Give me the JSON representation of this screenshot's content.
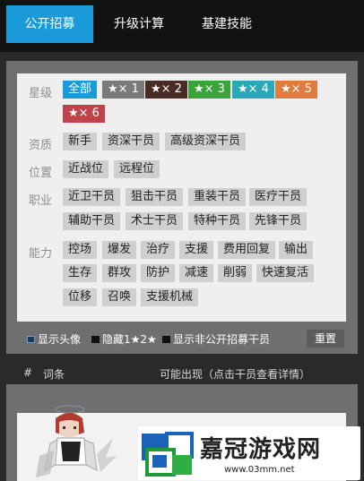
{
  "tabs": [
    {
      "label": "公开招募",
      "active": true
    },
    {
      "label": "升级计算",
      "active": false
    },
    {
      "label": "基建技能",
      "active": false
    }
  ],
  "filters": {
    "star": {
      "label": "星级",
      "options": [
        {
          "label": "全部",
          "color": "#1a9ad8"
        },
        {
          "label": "★× 1",
          "color": "#7a7a7a"
        },
        {
          "label": "★× 2",
          "color": "#4a2a24"
        },
        {
          "label": "★× 3",
          "color": "#3aa33a"
        },
        {
          "label": "★× 4",
          "color": "#2aa8b8"
        },
        {
          "label": "★× 5",
          "color": "#e07c3e"
        },
        {
          "label": "★× 6",
          "color": "#c0424b"
        }
      ]
    },
    "qualification": {
      "label": "资质",
      "options": [
        "新手",
        "资深干员",
        "高级资深干员"
      ]
    },
    "position": {
      "label": "位置",
      "options": [
        "近战位",
        "远程位"
      ]
    },
    "class": {
      "label": "职业",
      "options": [
        "近卫干员",
        "狙击干员",
        "重装干员",
        "医疗干员",
        "辅助干员",
        "术士干员",
        "特种干员",
        "先锋干员"
      ]
    },
    "ability": {
      "label": "能力",
      "options": [
        "控场",
        "爆发",
        "治疗",
        "支援",
        "费用回复",
        "输出",
        "生存",
        "群攻",
        "防护",
        "减速",
        "削弱",
        "快速复活",
        "位移",
        "召唤",
        "支援机械"
      ]
    }
  },
  "options_line": {
    "show_avatar": "显示头像",
    "hide_low": "隐藏1★2★",
    "show_non_public": "显示非公开招募干员",
    "reset": "重置"
  },
  "results_header": {
    "index": "#",
    "tags": "词条",
    "possible": "可能出现（点击干员查看详情）"
  },
  "watermark": {
    "name": "嘉冠游戏网",
    "url": "www.03mm.net"
  }
}
